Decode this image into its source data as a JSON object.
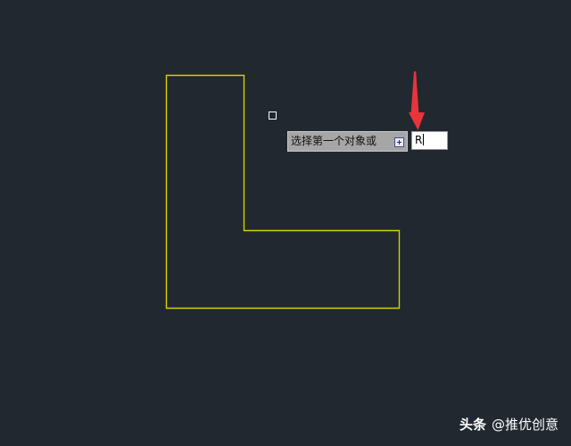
{
  "command_prompt": {
    "text": "选择第一个对象或",
    "expand_icon": "plus-box-icon"
  },
  "dynamic_input": {
    "value": "R"
  },
  "watermark": {
    "brand": "头条",
    "handle": "@推优创意"
  },
  "colors": {
    "background": "#212830",
    "polyline": "#d4d000",
    "pickbox": "#ffffff",
    "arrow": "#e8343b"
  }
}
